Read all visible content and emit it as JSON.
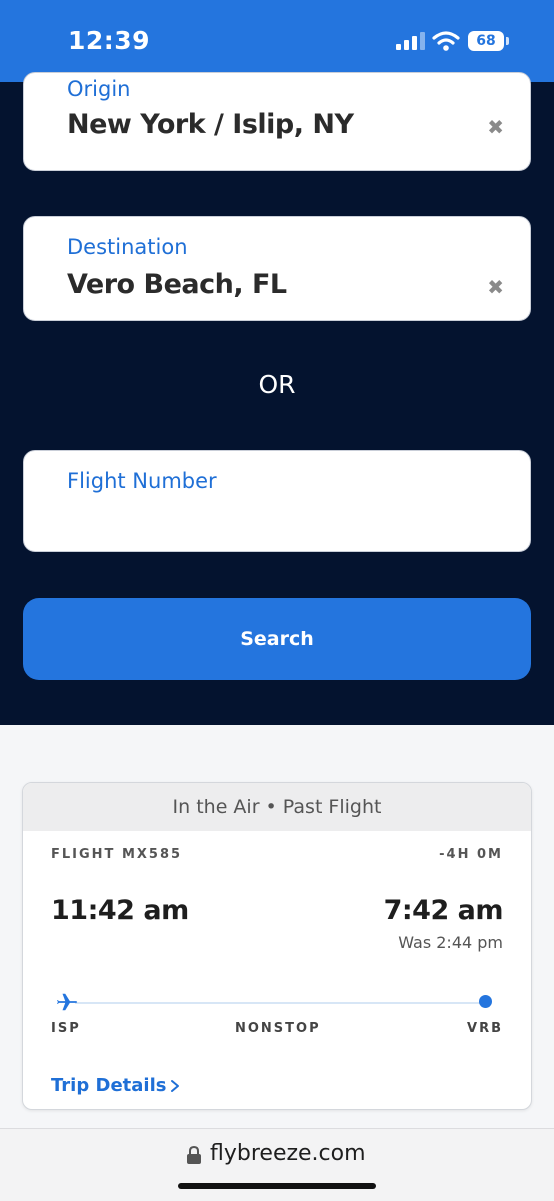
{
  "status_bar": {
    "time": "12:39",
    "battery": "68"
  },
  "search": {
    "origin_label": "Origin",
    "origin_value": "New York / Islip, NY",
    "destination_label": "Destination",
    "destination_value": "Vero Beach, FL",
    "clear_glyph": "✖",
    "or_text": "OR",
    "flight_number_label": "Flight Number",
    "flight_number_value": "",
    "search_button_label": "Search"
  },
  "flight_card": {
    "header": "In the Air • Past Flight",
    "flight_number": "FLIGHT MX585",
    "delay": "-4H 0M",
    "departure_time": "11:42 am",
    "arrival_time": "7:42 am",
    "was_time": "Was 2:44 pm",
    "origin_code": "ISP",
    "stops": "NONSTOP",
    "destination_code": "VRB",
    "trip_details_label": "Trip Details"
  },
  "browser": {
    "url": "flybreeze.com"
  },
  "icons": {
    "signal": "signal-icon",
    "wifi": "wifi-icon",
    "battery": "battery-icon",
    "clear": "clear-icon",
    "plane": "plane-icon",
    "chevron": "chevron-right-icon",
    "lock": "lock-icon"
  },
  "colors": {
    "brand_blue": "#2475de",
    "navy": "#04132f",
    "link_blue": "#1f6fd6"
  }
}
